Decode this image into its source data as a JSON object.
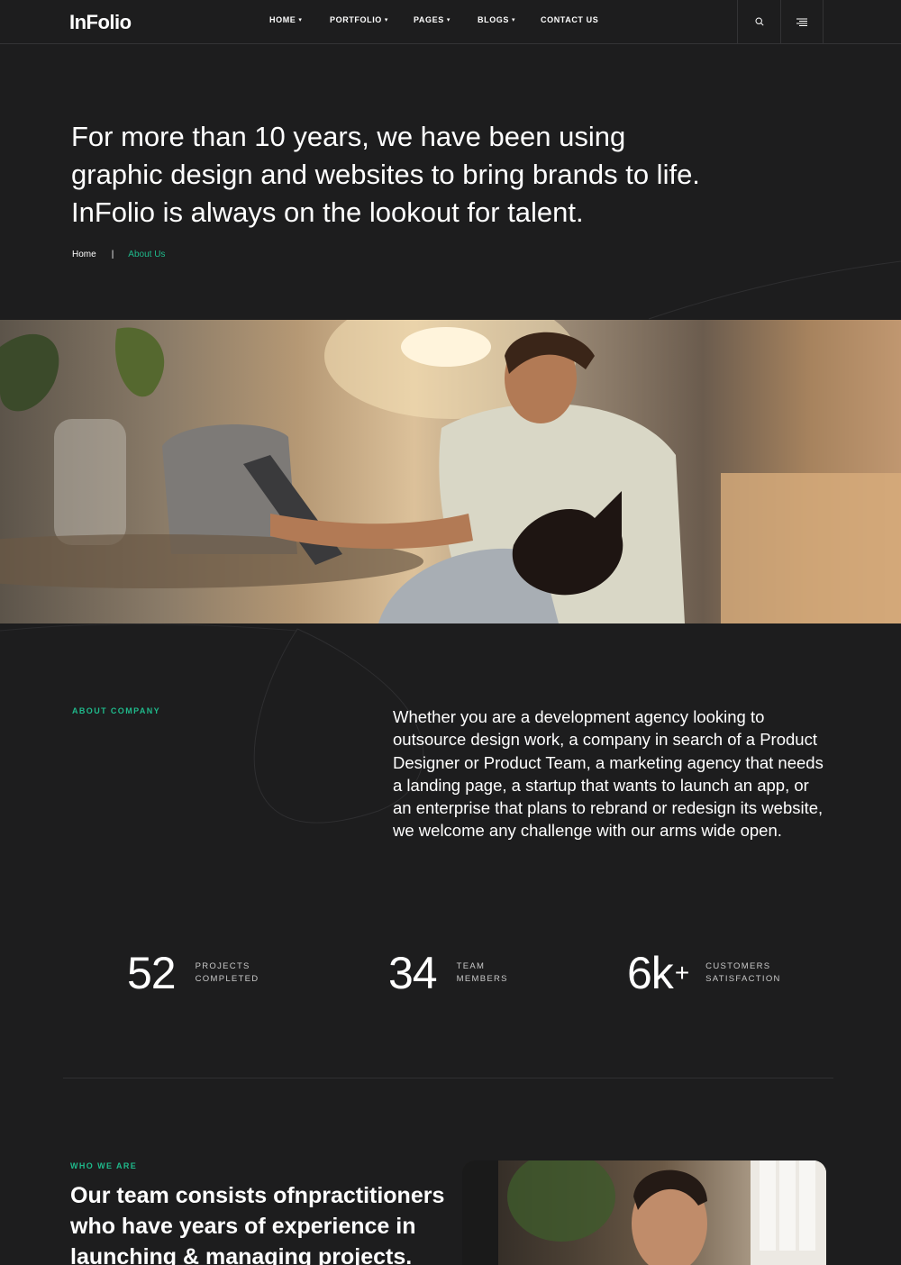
{
  "nav": {
    "logo": "InFolio",
    "menu": [
      {
        "label": "HOME",
        "has_dropdown": true
      },
      {
        "label": "PORTFOLIO",
        "has_dropdown": true
      },
      {
        "label": "PAGES",
        "has_dropdown": true
      },
      {
        "label": "BLOGS",
        "has_dropdown": true
      },
      {
        "label": "CONTACT US",
        "has_dropdown": false
      }
    ],
    "icons": [
      "search-icon",
      "hamburger-menu-icon"
    ]
  },
  "hero": {
    "title": "For more than 10 years, we have been using graphic design and websites to bring brands to life. InFolio is always on the lookout for talent.",
    "breadcrumb": {
      "home": "Home",
      "separator": "|",
      "current": "About Us"
    }
  },
  "about": {
    "eyebrow": "ABOUT COMPANY",
    "text": "Whether you are a development agency looking to outsource design work, a company in search of a Product Designer or Product Team, a marketing agency that needs a landing page, a startup that wants to launch an app, or an enterprise that plans to rebrand or redesign its website, we welcome any challenge with our arms wide open."
  },
  "stats": [
    {
      "value": "52",
      "suffix": "",
      "label_line1": "PROJECTS",
      "label_line2": "COMPLETED"
    },
    {
      "value": "34",
      "suffix": "",
      "label_line1": "TEAM",
      "label_line2": "MEMBERS"
    },
    {
      "value": "6k",
      "suffix": "+",
      "label_line1": "CUSTOMERS",
      "label_line2": "SATISFACTION"
    }
  ],
  "who": {
    "eyebrow": "WHO WE ARE",
    "title": "Our team consists ofnpractitioners who have years of experience in launching & managing projects."
  },
  "colors": {
    "background": "#1d1d1e",
    "accent": "#1fb98b",
    "text": "#ffffff",
    "border": "#333335"
  }
}
